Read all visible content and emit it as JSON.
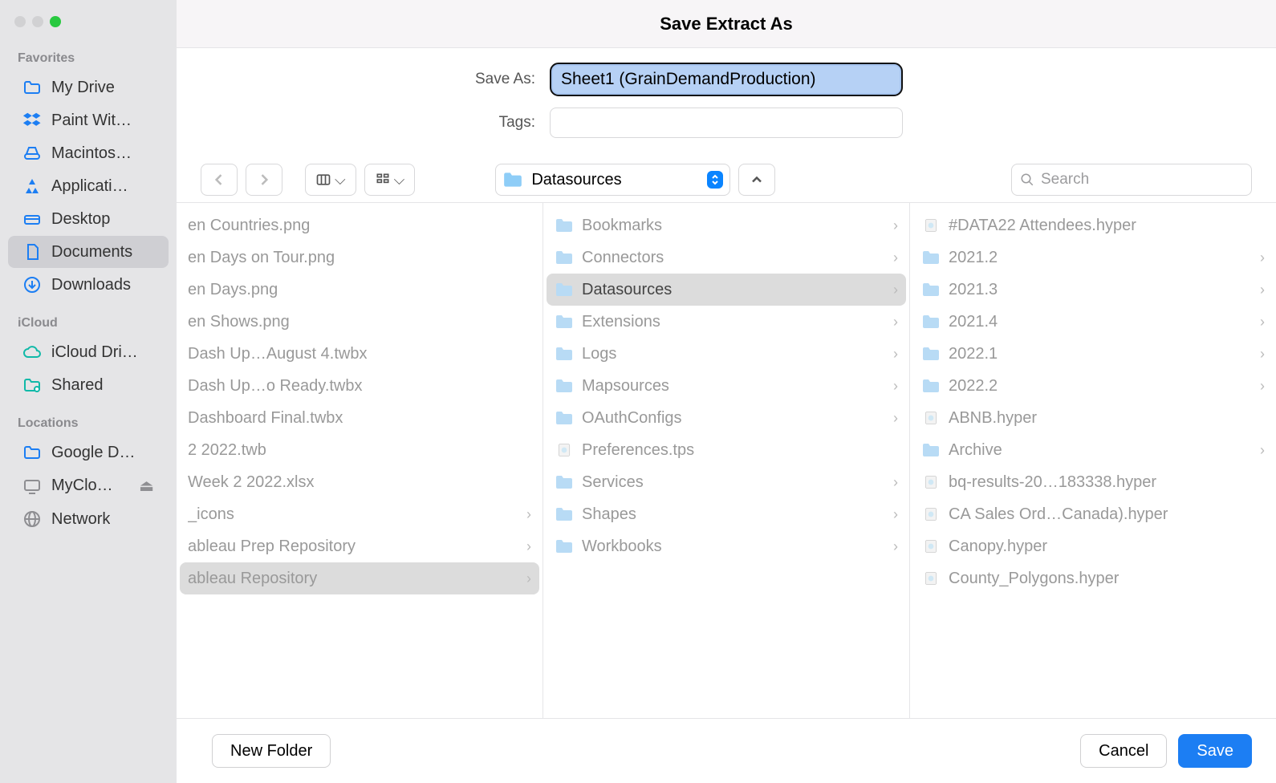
{
  "title": "Save Extract As",
  "saveAs": {
    "label": "Save As:",
    "value": "Sheet1 (GrainDemandProduction)"
  },
  "tags": {
    "label": "Tags:",
    "value": ""
  },
  "location": {
    "folder": "Datasources"
  },
  "search": {
    "placeholder": "Search"
  },
  "sidebar": {
    "sections": [
      {
        "label": "Favorites",
        "items": [
          {
            "name": "my-drive",
            "label": "My Drive",
            "icon": "folder"
          },
          {
            "name": "paint-with",
            "label": "Paint Wit…",
            "icon": "dropbox"
          },
          {
            "name": "macintosh-hd",
            "label": "Macintos…",
            "icon": "drive"
          },
          {
            "name": "applications",
            "label": "Applicati…",
            "icon": "app"
          },
          {
            "name": "desktop",
            "label": "Desktop",
            "icon": "desktop"
          },
          {
            "name": "documents",
            "label": "Documents",
            "icon": "doc",
            "selected": true
          },
          {
            "name": "downloads",
            "label": "Downloads",
            "icon": "download"
          }
        ]
      },
      {
        "label": "iCloud",
        "items": [
          {
            "name": "icloud-drive",
            "label": "iCloud Dri…",
            "icon": "cloud",
            "dim": true
          },
          {
            "name": "shared",
            "label": "Shared",
            "icon": "shared",
            "dim": true
          }
        ]
      },
      {
        "label": "Locations",
        "items": [
          {
            "name": "google-drive",
            "label": "Google D…",
            "icon": "folder"
          },
          {
            "name": "my-cloud",
            "label": "MyClo…",
            "icon": "display",
            "eject": true
          },
          {
            "name": "network",
            "label": "Network",
            "icon": "globe"
          }
        ]
      }
    ]
  },
  "columns": [
    [
      {
        "label": "en Countries.png",
        "dim": true
      },
      {
        "label": "en Days on Tour.png",
        "dim": true
      },
      {
        "label": "en Days.png",
        "dim": true
      },
      {
        "label": "en Shows.png",
        "dim": true
      },
      {
        "label": "Dash Up…August 4.twbx",
        "dim": true
      },
      {
        "label": "Dash Up…o Ready.twbx",
        "dim": true
      },
      {
        "label": "Dashboard Final.twbx",
        "dim": true
      },
      {
        "label": "2 2022.twb",
        "dim": true
      },
      {
        "label": "Week 2 2022.xlsx",
        "dim": true
      },
      {
        "label": "_icons",
        "chev": true
      },
      {
        "label": "ableau Prep Repository",
        "chev": true
      },
      {
        "label": "ableau Repository",
        "chev": true,
        "selected": true
      }
    ],
    [
      {
        "label": "Bookmarks",
        "folder": true,
        "chev": true
      },
      {
        "label": "Connectors",
        "folder": true,
        "chev": true
      },
      {
        "label": "Datasources",
        "folder": true,
        "chev": true,
        "selected": true,
        "dark": true
      },
      {
        "label": "Extensions",
        "folder": true,
        "chev": true
      },
      {
        "label": "Logs",
        "folder": true,
        "chev": true
      },
      {
        "label": "Mapsources",
        "folder": true,
        "chev": true
      },
      {
        "label": "OAuthConfigs",
        "folder": true,
        "chev": true
      },
      {
        "label": "Preferences.tps",
        "file": true
      },
      {
        "label": "Services",
        "folder": true,
        "chev": true
      },
      {
        "label": "Shapes",
        "folder": true,
        "chev": true
      },
      {
        "label": "Workbooks",
        "folder": true,
        "chev": true
      }
    ],
    [
      {
        "label": "#DATA22 Attendees.hyper",
        "file": true
      },
      {
        "label": "2021.2",
        "folder": true,
        "chev": true
      },
      {
        "label": "2021.3",
        "folder": true,
        "chev": true
      },
      {
        "label": "2021.4",
        "folder": true,
        "chev": true
      },
      {
        "label": "2022.1",
        "folder": true,
        "chev": true
      },
      {
        "label": "2022.2",
        "folder": true,
        "chev": true
      },
      {
        "label": "ABNB.hyper",
        "file": true
      },
      {
        "label": "Archive",
        "folder": true,
        "chev": true
      },
      {
        "label": "bq-results-20…183338.hyper",
        "file": true
      },
      {
        "label": "CA Sales Ord…Canada).hyper",
        "file": true
      },
      {
        "label": "Canopy.hyper",
        "file": true
      },
      {
        "label": "County_Polygons.hyper",
        "file": true
      }
    ]
  ],
  "footer": {
    "newFolder": "New Folder",
    "cancel": "Cancel",
    "save": "Save"
  }
}
